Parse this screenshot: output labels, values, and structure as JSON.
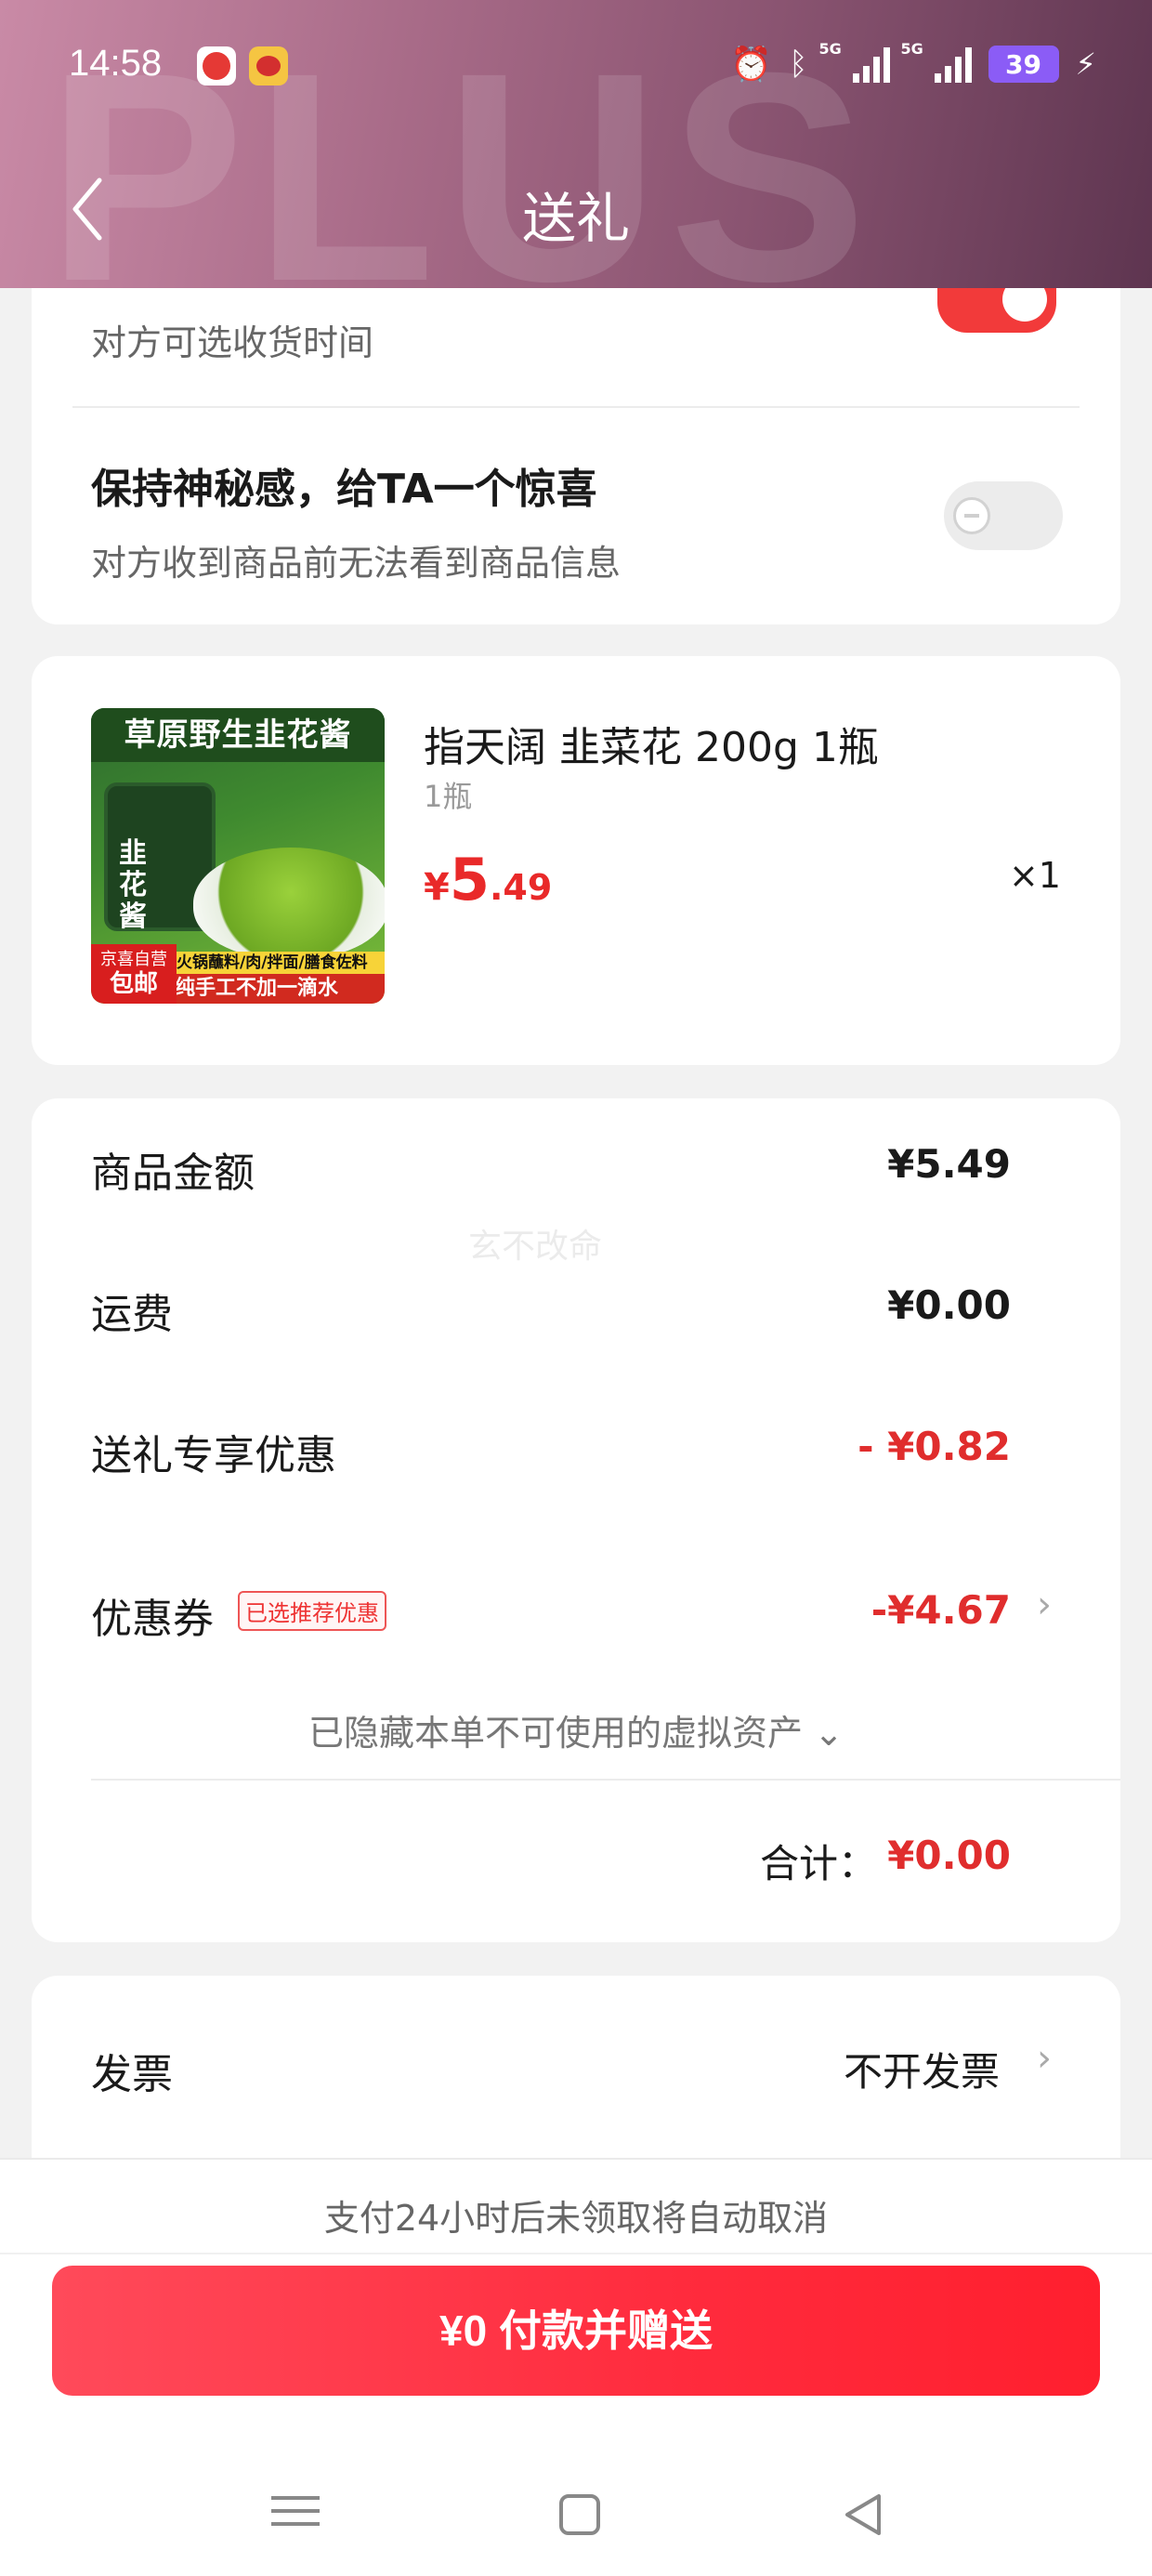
{
  "status_bar": {
    "time": "14:58",
    "battery": "39",
    "network1": "5G",
    "network2": "5G"
  },
  "header": {
    "title": "送礼",
    "watermark": "PLUS"
  },
  "options": {
    "delivery_time_sub": "对方可选收货时间",
    "delivery_time_enabled": true,
    "surprise_title": "保持神秘感，给TA一个惊喜",
    "surprise_sub": "对方收到商品前无法看到商品信息",
    "surprise_enabled": false
  },
  "product": {
    "name": "指天阔 韭菜花 200g 1瓶",
    "spec": "1瓶",
    "price_yen": "¥",
    "price_int": "5",
    "price_dec": ".49",
    "qty": "×1",
    "image": {
      "banner": "草原野生韭花酱",
      "jar_label": "韭花酱",
      "stripe": "火锅蘸料/肉/拌面/膳食佐料",
      "stripe2": "纯手工不加一滴水",
      "badge_top": "京喜自营",
      "badge_main": "包邮"
    }
  },
  "summary": {
    "faint_watermark": "玄不改命",
    "rows": [
      {
        "label": "商品金额",
        "value": "¥5.49"
      },
      {
        "label": "运费",
        "value": "¥0.00"
      },
      {
        "label": "送礼专享优惠",
        "value": "- ¥0.82"
      },
      {
        "label": "优惠券",
        "value": "-¥4.67"
      }
    ],
    "coupon_tag": "已选推荐优惠",
    "hidden_assets": "已隐藏本单不可使用的虚拟资产 ⌄",
    "total_label": "合计：",
    "total_value": "¥0.00"
  },
  "invoice": {
    "label": "发票",
    "value": "不开发票"
  },
  "bottom": {
    "notice": "支付24小时后未领取将自动取消",
    "pay_button": "¥0 付款并赠送"
  },
  "colors": {
    "accent": "#f23a3a",
    "price_red": "#e02d2d",
    "header_gradient_start": "#c98aa6",
    "header_gradient_end": "#5e3550"
  }
}
